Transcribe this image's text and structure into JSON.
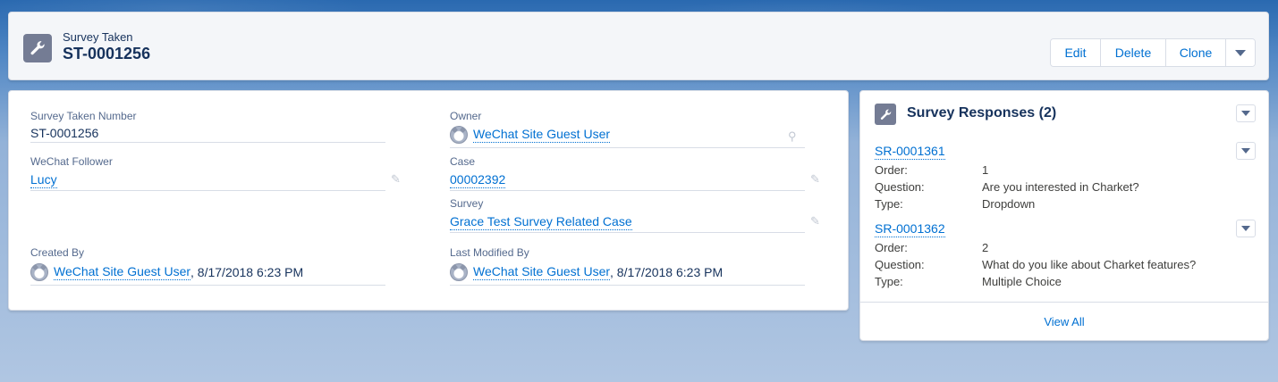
{
  "header": {
    "object_label": "Survey Taken",
    "record_name": "ST-0001256",
    "icon": "wrench-icon",
    "buttons": {
      "edit": "Edit",
      "delete": "Delete",
      "clone": "Clone"
    }
  },
  "details": {
    "survey_taken_number": {
      "label": "Survey Taken Number",
      "value": "ST-0001256"
    },
    "owner": {
      "label": "Owner",
      "value": "WeChat Site Guest User"
    },
    "wechat_follower": {
      "label": "WeChat Follower",
      "value": "Lucy"
    },
    "case": {
      "label": "Case",
      "value": "00002392"
    },
    "survey": {
      "label": "Survey",
      "value": "Grace Test Survey Related Case"
    },
    "created_by": {
      "label": "Created By",
      "user": "WeChat Site Guest User",
      "date": ", 8/17/2018 6:23 PM"
    },
    "last_modified_by": {
      "label": "Last Modified By",
      "user": "WeChat Site Guest User",
      "date": ", 8/17/2018 6:23 PM"
    }
  },
  "related": {
    "title": "Survey Responses (2)",
    "icon": "wrench-icon",
    "records": [
      {
        "name": "SR-0001361",
        "order_label": "Order:",
        "order": "1",
        "question_label": "Question:",
        "question": "Are you interested in Charket?",
        "type_label": "Type:",
        "type": "Dropdown"
      },
      {
        "name": "SR-0001362",
        "order_label": "Order:",
        "order": "2",
        "question_label": "Question:",
        "question": "What do you like about Charket features?",
        "type_label": "Type:",
        "type": "Multiple Choice"
      }
    ],
    "view_all": "View All"
  },
  "colors": {
    "link": "#0070d2",
    "text": "#16325c",
    "label": "#54698d",
    "icon_bg": "#747c94"
  }
}
